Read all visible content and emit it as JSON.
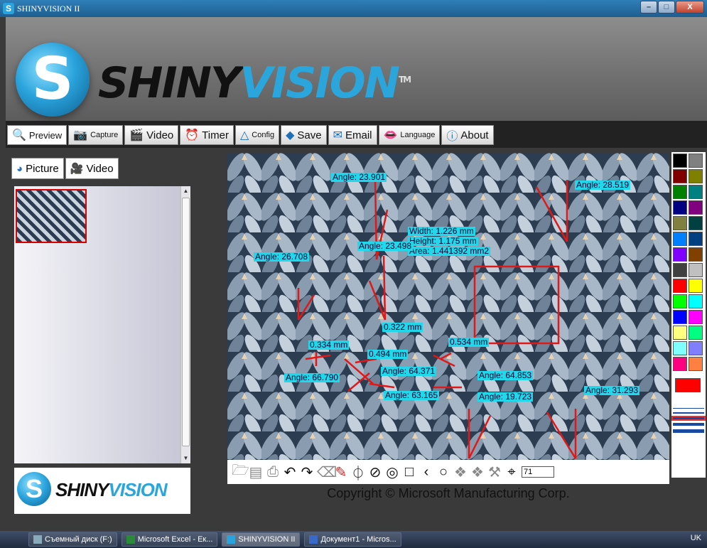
{
  "window": {
    "title": "SHINYVISION II",
    "min": "–",
    "max": "□",
    "close": "X"
  },
  "brand": {
    "logo_a": "SHINY",
    "logo_b": "VISION",
    "tm": "TM",
    "footer_a": "SHINY",
    "footer_b": "VISION",
    "s_letter": "S"
  },
  "tabs": [
    {
      "label": "Preview",
      "icon": "magnifier-icon"
    },
    {
      "label": "Capture",
      "icon": "camera-icon"
    },
    {
      "label": "Video",
      "icon": "video-icon"
    },
    {
      "label": "Timer",
      "icon": "alarm-clock-icon"
    },
    {
      "label": "Config",
      "icon": "config-icon"
    },
    {
      "label": "Save",
      "icon": "save-icon"
    },
    {
      "label": "Email",
      "icon": "envelope-icon"
    },
    {
      "label": "Language",
      "icon": "lips-icon"
    },
    {
      "label": "About",
      "icon": "info-icon"
    }
  ],
  "left_tabs": [
    {
      "label": "Picture",
      "icon": "picture-icon"
    },
    {
      "label": "Video",
      "icon": "film-camera-icon"
    }
  ],
  "measurements": [
    "Angle: 23.901",
    "Angle: 28.519",
    "Width: 1.226 mm",
    "Height: 1.175 mm",
    "Area: 1.441392 mm2",
    "Angle: 23.498",
    "Angle: 26.708",
    "0.322 mm",
    "0.334 mm",
    "0.534 mm",
    "0.494 mm",
    "Angle: 64.371",
    "Angle: 66.790",
    "Angle: 64.853",
    "Angle: 63.165",
    "Angle: 19.723",
    "Angle: 31.293"
  ],
  "zoom": {
    "value": "71"
  },
  "copyright": "Copyright © Microsoft Manufacturing Corp.",
  "palette_colors": [
    "#000000",
    "#808080",
    "#800000",
    "#808000",
    "#008000",
    "#008080",
    "#000080",
    "#800080",
    "#808040",
    "#004040",
    "#0080ff",
    "#004080",
    "#8000ff",
    "#804000",
    "#404040",
    "#c0c0c0",
    "#ff0000",
    "#ffff00",
    "#00ff00",
    "#00ffff",
    "#0000ff",
    "#ff00ff",
    "#ffff80",
    "#00ff80",
    "#80ffff",
    "#8080ff",
    "#ff0080",
    "#ff8040"
  ],
  "taskbar": {
    "items": [
      "Съемный диск (F:)",
      "Microsoft Excel - Ек...",
      "SHINYVISION II",
      "Документ1 - Micros..."
    ],
    "tray": "UK"
  }
}
